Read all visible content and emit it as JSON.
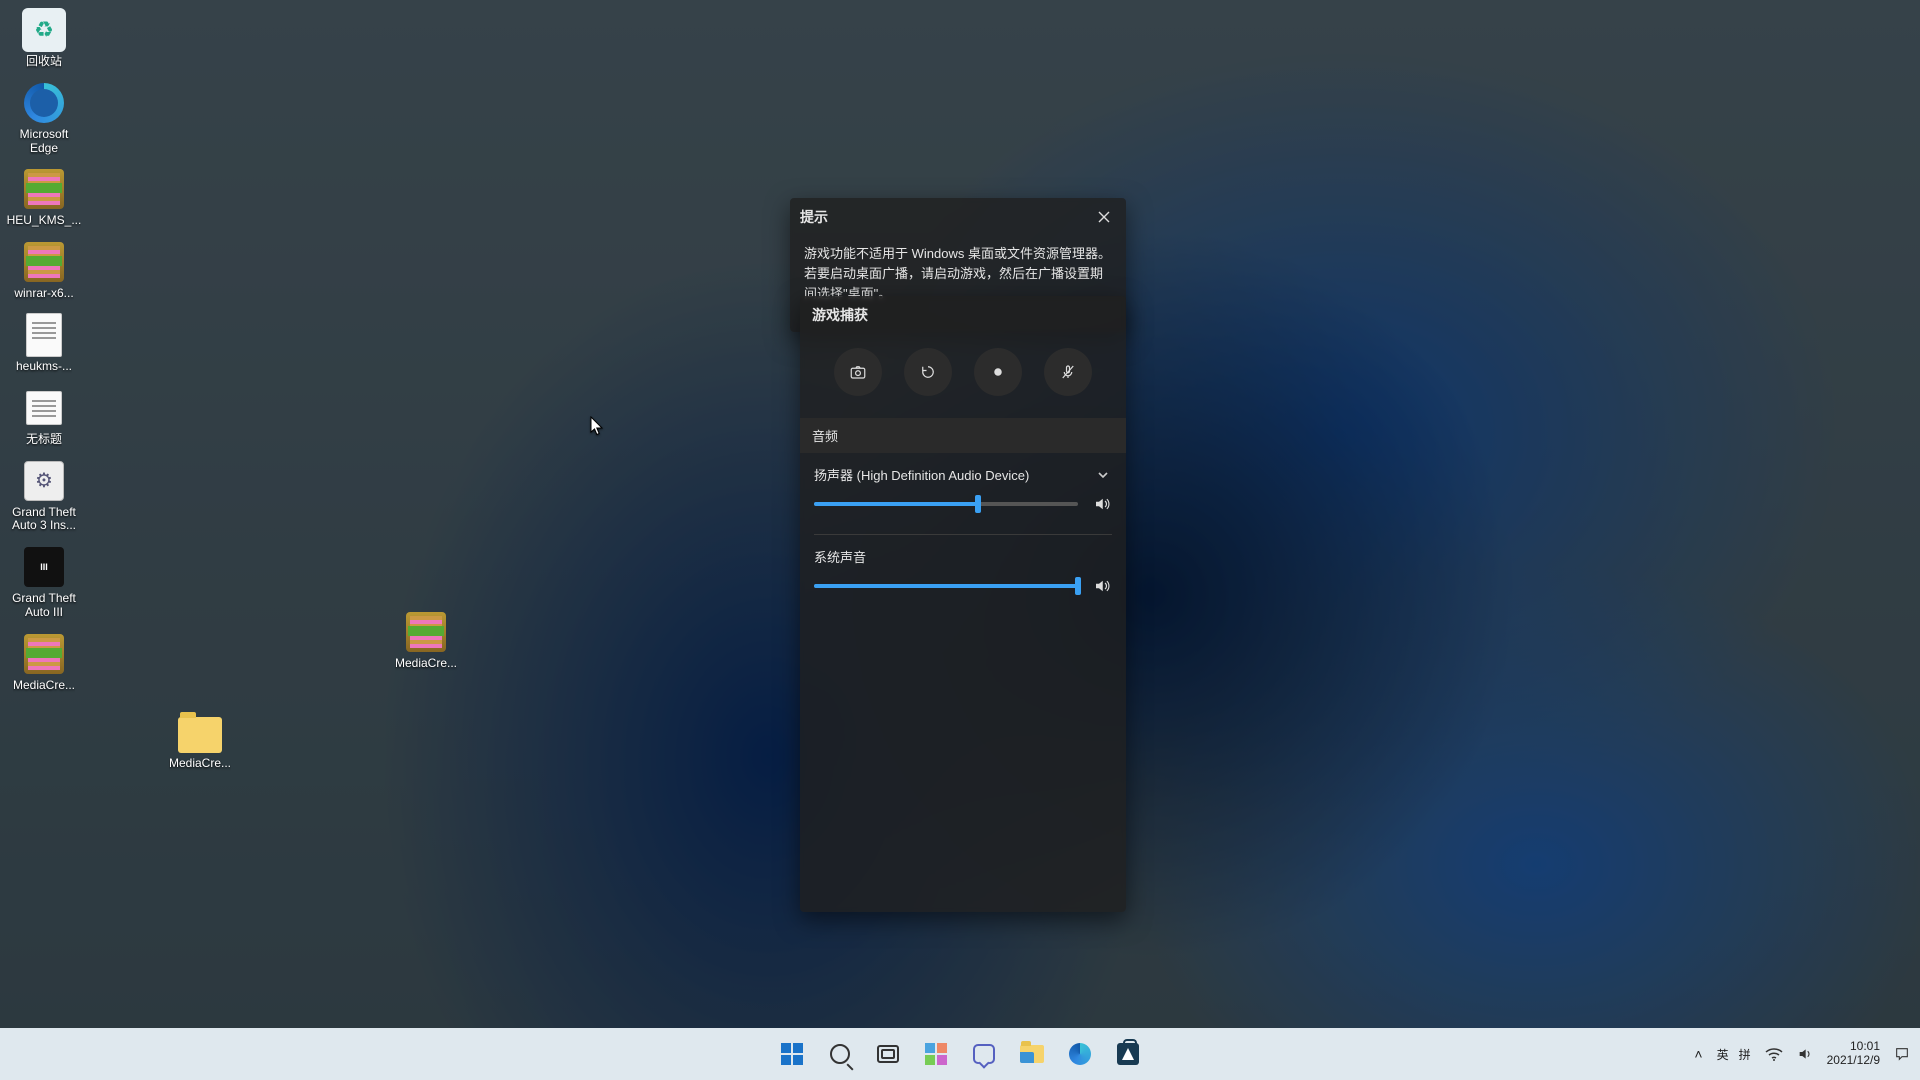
{
  "desktop_icons": {
    "recycle": "回收站",
    "edge": "Microsoft Edge",
    "heu_kms": "HEU_KMS_...",
    "winrar": "winrar-x6...",
    "heukms_txt": "heukms-...",
    "untitled": "无标题",
    "gta3_ins": "Grand Theft Auto 3 Ins...",
    "gta3": "Grand Theft Auto III",
    "mediacre_exe": "MediaCre...",
    "mediacre_folder": "MediaCre...",
    "mediacre_desk": "MediaCre..."
  },
  "gamebar": {
    "hint_title": "提示",
    "hint_body": "游戏功能不适用于 Windows 桌面或文件资源管理器。若要启动桌面广播，请启动游戏，然后在广播设置期间选择\"桌面\"。",
    "capture_title": "游戏捕获",
    "audio_section": "音频",
    "device_label": "扬声器 (High Definition Audio Device)",
    "device_volume_pct": 62,
    "system_sound_label": "系统声音",
    "system_volume_pct": 100
  },
  "tray": {
    "chevron": "⌃",
    "ime1": "英",
    "ime2": "拼",
    "time": "10:01",
    "date": "2021/12/9"
  }
}
